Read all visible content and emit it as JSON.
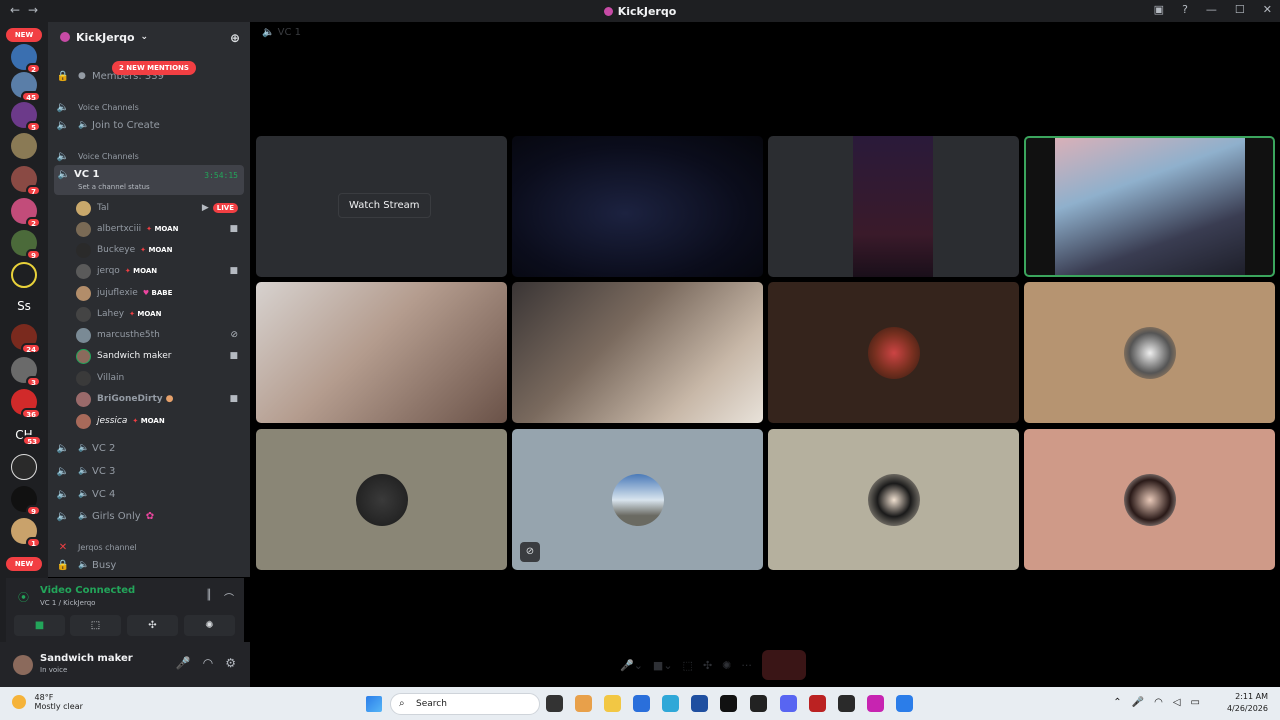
{
  "window": {
    "title": "KickJerqo"
  },
  "server": {
    "name": "KickJerqo",
    "mentions_pill": "2 NEW MENTIONS",
    "members_label": "Members: 339"
  },
  "guilds": {
    "new_label": "NEW",
    "badges": [
      "2",
      "45",
      "5",
      "7",
      "2",
      "9",
      "24",
      "3",
      "36",
      "53",
      "9",
      "1"
    ],
    "text_items": [
      "Ss",
      "CH"
    ]
  },
  "channels": {
    "cat1": "Voice Channels",
    "join_to_create": "Join to Create",
    "cat2": "Voice Channels",
    "active": {
      "name": "VC 1",
      "timer": "3:54:15",
      "status": "Set a channel status"
    },
    "members": [
      {
        "name": "Tal",
        "tag": "",
        "right": "live"
      },
      {
        "name": "albertxciii",
        "tag": "MOAN",
        "right": "cam"
      },
      {
        "name": "Buckeye",
        "tag": "MOAN",
        "right": ""
      },
      {
        "name": "jerqo",
        "tag": "MOAN",
        "right": "cam"
      },
      {
        "name": "jujuflexie",
        "tag": "BABE",
        "right": ""
      },
      {
        "name": "Lahey",
        "tag": "MOAN",
        "right": ""
      },
      {
        "name": "marcusthe5th",
        "tag": "",
        "right": "mute"
      },
      {
        "name": "Sandwich maker",
        "tag": "",
        "right": "cam"
      },
      {
        "name": "Villain",
        "tag": "",
        "right": ""
      },
      {
        "name": "BriGoneDirty",
        "tag": "",
        "right": "cam"
      },
      {
        "name": "jessica",
        "tag": "MOAN",
        "right": ""
      }
    ],
    "live_label": "LIVE",
    "others": [
      "VC 2",
      "VC 3",
      "VC 4",
      "Girls Only"
    ],
    "cat3": "Jerqos channel",
    "busy": "Busy"
  },
  "voice_panel": {
    "status": "Video Connected",
    "sub": "VC 1 / KickJerqo"
  },
  "user": {
    "name": "Sandwich maker",
    "status": "In voice"
  },
  "stage": {
    "vc_label": "VC 1",
    "watch_stream": "Watch Stream"
  },
  "taskbar": {
    "temp": "48°F",
    "condition": "Mostly clear",
    "search_placeholder": "Search",
    "time": "2:11 AM",
    "date": "4/26/2026"
  },
  "colors": {
    "accent_green": "#23a55a",
    "badge_red": "#f23f43",
    "speaking_outline": "#3ba55d"
  }
}
